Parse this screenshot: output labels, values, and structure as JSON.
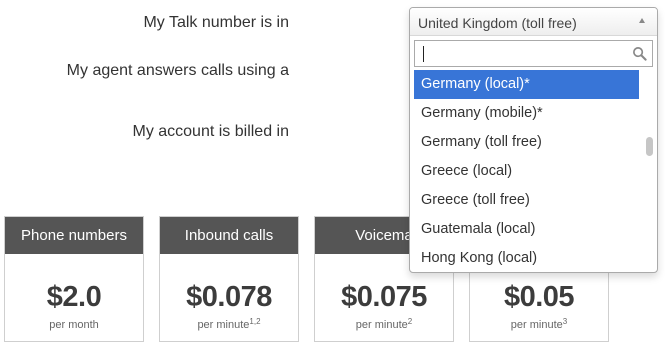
{
  "form": {
    "talk_number_label": "My Talk number is in",
    "agent_label": "My agent answers calls using a",
    "billed_label": "My account is billed in"
  },
  "dropdown": {
    "selected_value": "United Kingdom (toll free)",
    "search_value": "",
    "options": [
      "Germany (local)*",
      "Germany (mobile)*",
      "Germany (toll free)",
      "Greece (local)",
      "Greece (toll free)",
      "Guatemala (local)",
      "Hong Kong (local)"
    ],
    "highlighted_option": "Germany (local)*"
  },
  "pricing": [
    {
      "heading": "Phone numbers",
      "price": "$2.0",
      "unit": "per month",
      "footnote": ""
    },
    {
      "heading": "Inbound calls",
      "price": "$0.078",
      "unit": "per minute",
      "footnote": "1,2"
    },
    {
      "heading": "Voicema",
      "price": "$0.075",
      "unit": "per minute",
      "footnote": "2"
    },
    {
      "heading": "",
      "price": "$0.05",
      "unit": "per minute",
      "footnote": "3"
    }
  ],
  "colors": {
    "card_header": "#555555",
    "highlight": "#3875d7"
  }
}
